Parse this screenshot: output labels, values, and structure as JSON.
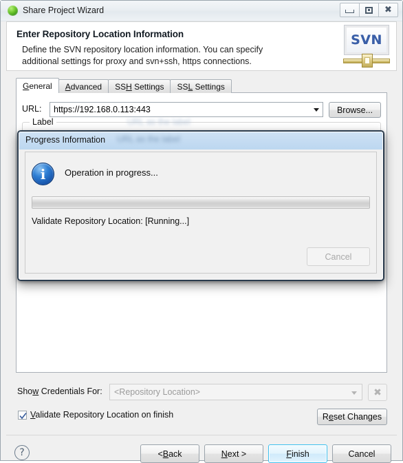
{
  "window": {
    "title": "Share Project Wizard",
    "icon": "green-sphere-icon",
    "buttons": {
      "minimize": "minimize-icon",
      "maximize": "maximize-icon",
      "close": "close-icon"
    }
  },
  "header": {
    "title": "Enter Repository Location Information",
    "description": "Define the SVN repository location information. You can specify additional settings for proxy and svn+ssh, https connections.",
    "logo_text": "SVN"
  },
  "tabs": [
    {
      "label": "General",
      "mnemonic": "G",
      "selected": true
    },
    {
      "label": "Advanced",
      "mnemonic": "A",
      "selected": false
    },
    {
      "label": "SSH Settings",
      "mnemonic": "H",
      "selected": false
    },
    {
      "label": "SSL Settings",
      "mnemonic": "L",
      "selected": false
    }
  ],
  "general": {
    "url_label": "URL:",
    "url_value": "https://192.168.0.113:443",
    "url_placeholder": "https://",
    "browse_label": "Browse...",
    "group_label": "Label",
    "group_ghost_text": "URL as the label"
  },
  "credentials": {
    "label_prefix": "Sho",
    "label_mnemonic": "w",
    "label_suffix": " Credentials For:",
    "value": "<Repository Location>",
    "clear_icon": "close-x-icon"
  },
  "validate": {
    "checked": true,
    "label_prefix": "",
    "label_mnemonic": "V",
    "label_suffix": "alidate Repository Location on finish",
    "reset_label_prefix": "R",
    "reset_label_mnemonic": "e",
    "reset_label_suffix": "set Changes",
    "reset_label": "Reset Changes"
  },
  "footer": {
    "help_icon": "question-mark-icon",
    "buttons": [
      {
        "label": "< Back",
        "mnemonic": "B",
        "primary": false
      },
      {
        "label": "Next >",
        "mnemonic": "N",
        "primary": false
      },
      {
        "label": "Finish",
        "mnemonic": "F",
        "primary": true
      },
      {
        "label": "Cancel",
        "mnemonic": "",
        "primary": false
      }
    ]
  },
  "progress_dialog": {
    "title": "Progress Information",
    "ghost_text": "URL as the label",
    "icon": "info-icon",
    "operation_text": "Operation in progress...",
    "progress_percent": 0,
    "status_text": "Validate Repository Location: [Running...]",
    "cancel_label": "Cancel",
    "cancel_enabled": false
  },
  "colors": {
    "accent": "#3cc0ef",
    "dialog_border": "#2b3c4e",
    "dialog_title": "#c5dcf2",
    "info_blue": "#2f7fd4",
    "svn_blue": "#3a5fa8"
  }
}
